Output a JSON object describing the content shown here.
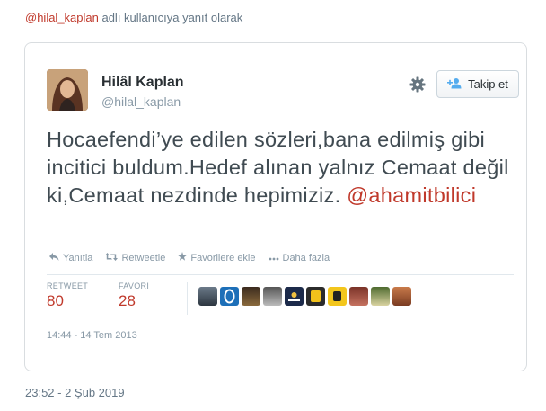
{
  "reply": {
    "handle": "@hilal_kaplan",
    "suffix": " adlı kullanıcıya yanıt olarak"
  },
  "tweet": {
    "name": "Hilâl Kaplan",
    "username": "@hilal_kaplan",
    "follow_label": "Takip et",
    "text": "Hocaefendi’ye edilen sözleri,bana edilmiş gibi incitici buldum.Hedef alınan yalnız Cemaat değil ki,Cemaat nezdinde hepimiziz. ",
    "mention": "@ahamitbilici",
    "actions": {
      "reply": "Yanıtla",
      "retweet": "Retweetle",
      "favorite": "Favorilere ekle",
      "more": "Daha fazla"
    },
    "stats": {
      "retweet_label": "RETWEET",
      "retweet_count": "80",
      "favorite_label": "FAVORI",
      "favorite_count": "28"
    },
    "date": "14:44 - 14 Tem 2013"
  },
  "timestamp": "23:52 - 2 Şub 2019",
  "colors": {
    "accent": "#c0392b",
    "muted": "#8899a6",
    "text": "#404b52"
  }
}
